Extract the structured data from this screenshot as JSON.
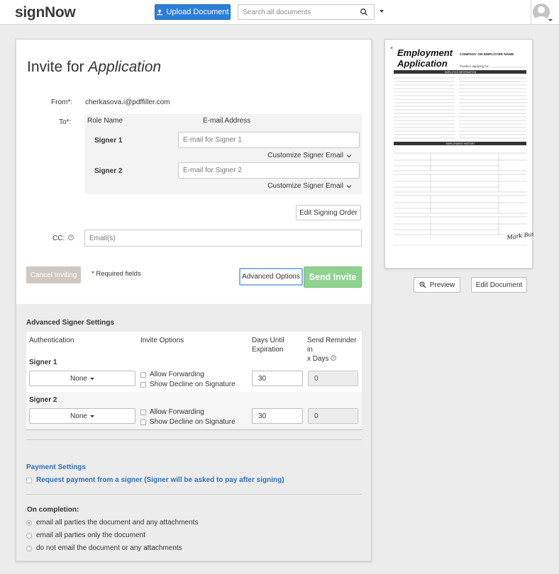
{
  "header": {
    "logo": "signNow",
    "upload_label": "Upload Document",
    "search_placeholder": "Search all documents"
  },
  "invite": {
    "title_prefix": "Invite for ",
    "title_doc": "Application",
    "from_label": "From*:",
    "from_value": "cherkasova.i@pdffiller.com",
    "to_label": "To*:",
    "col_role": "Role Name",
    "col_email": "E-mail Address",
    "signers": [
      {
        "name": "Signer 1",
        "placeholder": "E-mail for Signer 1",
        "customize": "Customize Signer Email"
      },
      {
        "name": "Signer 2",
        "placeholder": "E-mail for Signer 2",
        "customize": "Customize Signer Email"
      }
    ],
    "edit_order_label": "Edit Signing Order",
    "cc_label": "CC:",
    "cc_placeholder": "Email(s)",
    "cancel_label": "Cancel Inviting",
    "required_note": "* Required fields",
    "advanced_label": "Advanced Options",
    "send_label": "Send Invite"
  },
  "advanced": {
    "title": "Advanced Signer Settings",
    "col_auth": "Authentication",
    "col_invite": "Invite Options",
    "col_days_1": "Days Until",
    "col_days_2": "Expiration",
    "col_remind_1": "Send Reminder in",
    "col_remind_2": "x Days",
    "rows": [
      {
        "signer": "Signer 1",
        "auth": "None",
        "opt_forward": "Allow Forwarding",
        "opt_decline": "Show Decline on Signature",
        "days": "30",
        "remind": "0"
      },
      {
        "signer": "Signer 2",
        "auth": "None",
        "opt_forward": "Allow Forwarding",
        "opt_decline": "Show Decline on Signature",
        "days": "30",
        "remind": "0"
      }
    ]
  },
  "payment": {
    "title": "Payment Settings",
    "request_label": "Request payment from a signer (Signer will be asked to pay after signing)"
  },
  "completion": {
    "title": "On completion:",
    "options": [
      {
        "label": "email all parties the document and any attachments",
        "selected": true
      },
      {
        "label": "email all parties only the document",
        "selected": false
      },
      {
        "label": "do not email the document or any attachments",
        "selected": false
      }
    ]
  },
  "document": {
    "title_1": "Employment",
    "title_2": "Application",
    "company": "COMPANY OR EMPLOYER NAME",
    "position": "Position applying for:",
    "section_1": "EMPLOYEE INFORMATION",
    "section_2": "EMPLOYMENT HISTORY",
    "signature": "Mark Bush",
    "preview_label": "Preview",
    "edit_label": "Edit Document"
  }
}
